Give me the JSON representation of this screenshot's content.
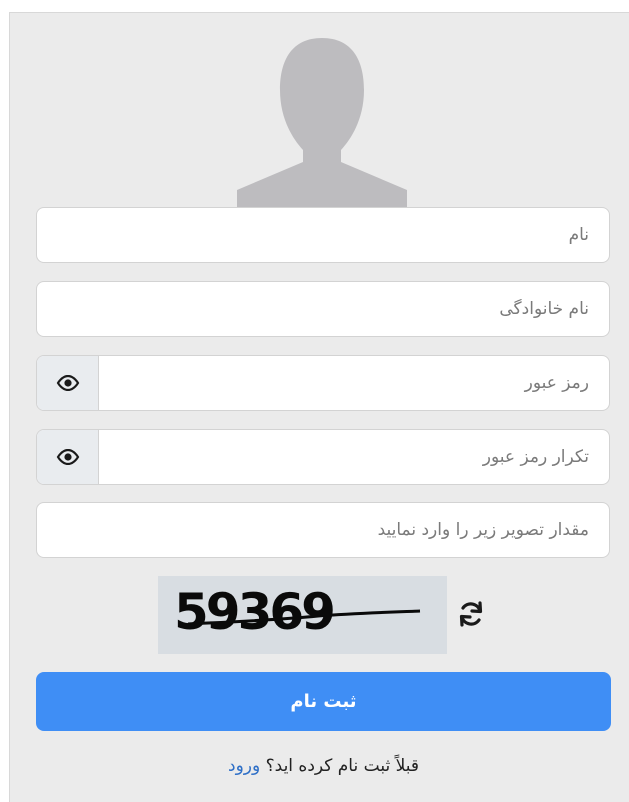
{
  "form": {
    "first_name_placeholder": "نام",
    "last_name_placeholder": "نام خانوادگی",
    "password_placeholder": "رمز عبور",
    "confirm_password_placeholder": "تکرار رمز عبور",
    "captcha_input_placeholder": "مقدار تصویر زیر را وارد نمایید",
    "captcha_value": "59369",
    "submit_label": "ثبت نام"
  },
  "footer": {
    "prompt_text": "قبلاً ثبت نام کرده اید؟",
    "login_link": "ورود"
  },
  "icons": {
    "avatar": "user-silhouette-icon",
    "password_toggle": "eye-icon",
    "captcha_refresh": "refresh-icon"
  },
  "colors": {
    "panel_bg": "#ebebeb",
    "primary": "#3f8ef5",
    "link": "#2e6fc7",
    "avatar": "#bdbcbf"
  }
}
